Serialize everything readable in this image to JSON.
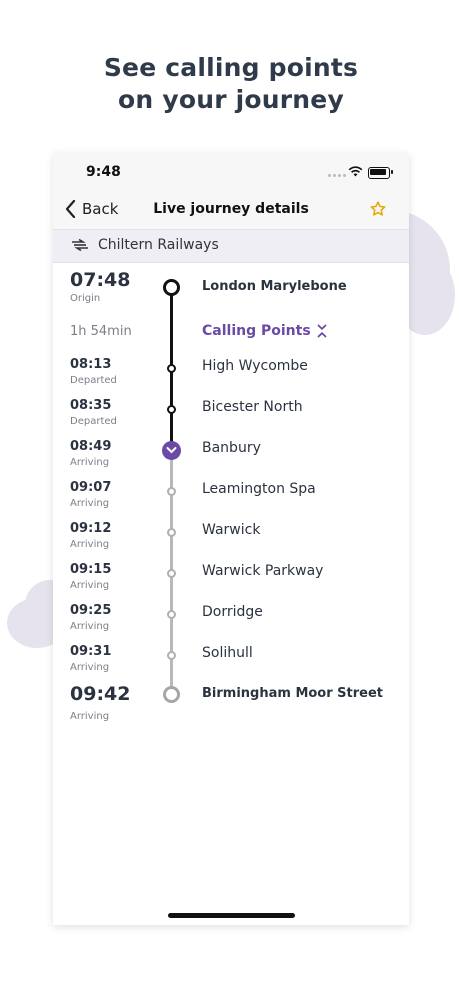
{
  "headline": {
    "line1": "See calling points",
    "line2": "on your journey"
  },
  "status_bar": {
    "time": "9:48"
  },
  "nav": {
    "back_label": "Back",
    "title": "Live journey details",
    "favourite_icon": "star-icon"
  },
  "operator": {
    "name": "Chiltern Railways",
    "icon": "national-rail-icon"
  },
  "journey": {
    "origin": {
      "time": "07:48",
      "status": "Origin",
      "name": "London Marylebone"
    },
    "duration": "1h 54min",
    "calling_points_label": "Calling Points",
    "stops": [
      {
        "time": "08:13",
        "status": "Departed",
        "name": "High Wycombe"
      },
      {
        "time": "08:35",
        "status": "Departed",
        "name": "Bicester North"
      },
      {
        "time": "08:49",
        "status": "Arriving",
        "name": "Banbury"
      },
      {
        "time": "09:07",
        "status": "Arriving",
        "name": "Leamington Spa"
      },
      {
        "time": "09:12",
        "status": "Arriving",
        "name": "Warwick"
      },
      {
        "time": "09:15",
        "status": "Arriving",
        "name": "Warwick Parkway"
      },
      {
        "time": "09:25",
        "status": "Arriving",
        "name": "Dorridge"
      },
      {
        "time": "09:31",
        "status": "Arriving",
        "name": "Solihull"
      }
    ],
    "destination": {
      "time": "09:42",
      "status": "Arriving",
      "name": "Birmingham Moor Street"
    }
  },
  "colors": {
    "accent": "#6b4aa6",
    "star": "#e5a800",
    "passed_line": "#111111",
    "future_line": "#b8b8b8"
  }
}
